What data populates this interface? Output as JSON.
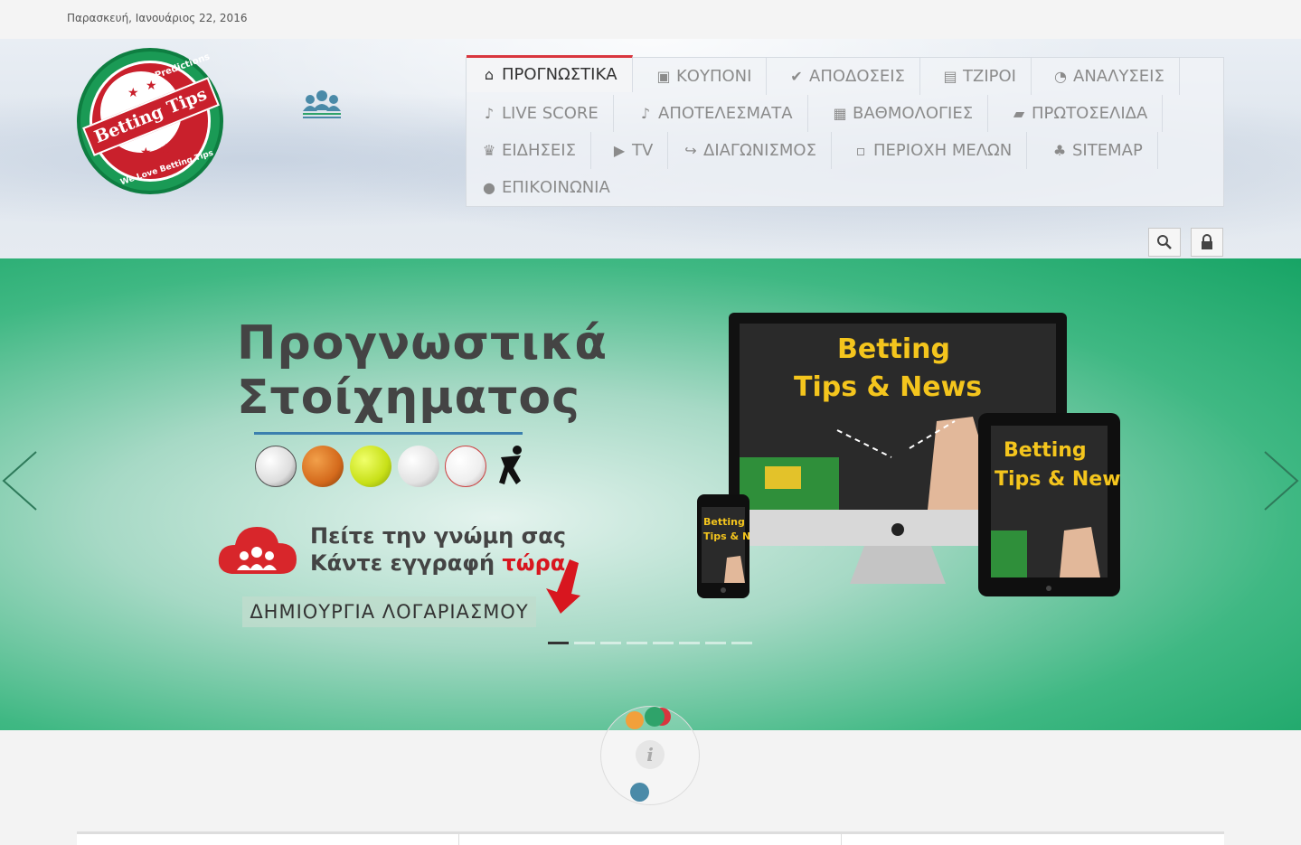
{
  "topbar": {
    "date": "Παρασκευή, Ιανουάριος 22, 2016"
  },
  "logo": {
    "arc_top": "Sports & Predictions",
    "main": "Betting Tips",
    "arc_bottom": "We Love Betting Tips"
  },
  "nav": {
    "items": [
      {
        "label": "ΠΡΟΓΝΩΣΤΙΚΑ",
        "icon": "home-icon",
        "active": true
      },
      {
        "label": "ΚΟΥΠΟΝΙ",
        "icon": "briefcase-icon"
      },
      {
        "label": "ΑΠΟΔΟΣΕΙΣ",
        "icon": "check-icon"
      },
      {
        "label": "ΤΖΙΡΟΙ",
        "icon": "money-icon"
      },
      {
        "label": "ΑΝΑΛΥΣΕΙΣ",
        "icon": "dashboard-icon"
      },
      {
        "label": "LIVE SCORE",
        "icon": "bell-icon"
      },
      {
        "label": "ΑΠΟΤΕΛΕΣΜΑΤΑ",
        "icon": "bell-icon"
      },
      {
        "label": "ΒΑΘΜΟΛΟΓΙΕΣ",
        "icon": "table-icon"
      },
      {
        "label": "ΠΡΩΤΟΣΕΛΙΔΑ",
        "icon": "book-icon"
      },
      {
        "label": "ΕΙΔΗΣΕΙΣ",
        "icon": "trophy-icon"
      },
      {
        "label": "TV",
        "icon": "play-icon"
      },
      {
        "label": "ΔΙΑΓΩΝΙΣΜΟΣ",
        "icon": "share-icon"
      },
      {
        "label": "ΠΕΡΙΟΧΗ ΜΕΛΩΝ",
        "icon": "unlock-icon"
      },
      {
        "label": "SITEMAP",
        "icon": "sitemap-icon"
      },
      {
        "label": "ΕΠΙΚΟΙΝΩΝΙΑ",
        "icon": "comment-icon"
      }
    ]
  },
  "tools": {
    "search_icon": "search-icon",
    "lock_icon": "lock-icon"
  },
  "hero": {
    "title_line1": "Προγνωστικά",
    "title_line2": "Στοίχηματος",
    "cta_line1": "Πείτε την γνώμη σας",
    "cta_line2_prefix": "Κάντε εγγραφή",
    "cta_line2_highlight": "τώρα",
    "cta_button": "ΔΗΜΙΟΥΡΓΙΑ ΛΟΓΑΡΙΑΣΜΟΥ",
    "device_text_line1": "Betting",
    "device_text_line2": "Tips & News",
    "slide_count": 8,
    "active_slide": 1
  },
  "colors": {
    "accent_red": "#d9363e",
    "brand_green": "#17a465",
    "cta_red": "#d8161f"
  }
}
